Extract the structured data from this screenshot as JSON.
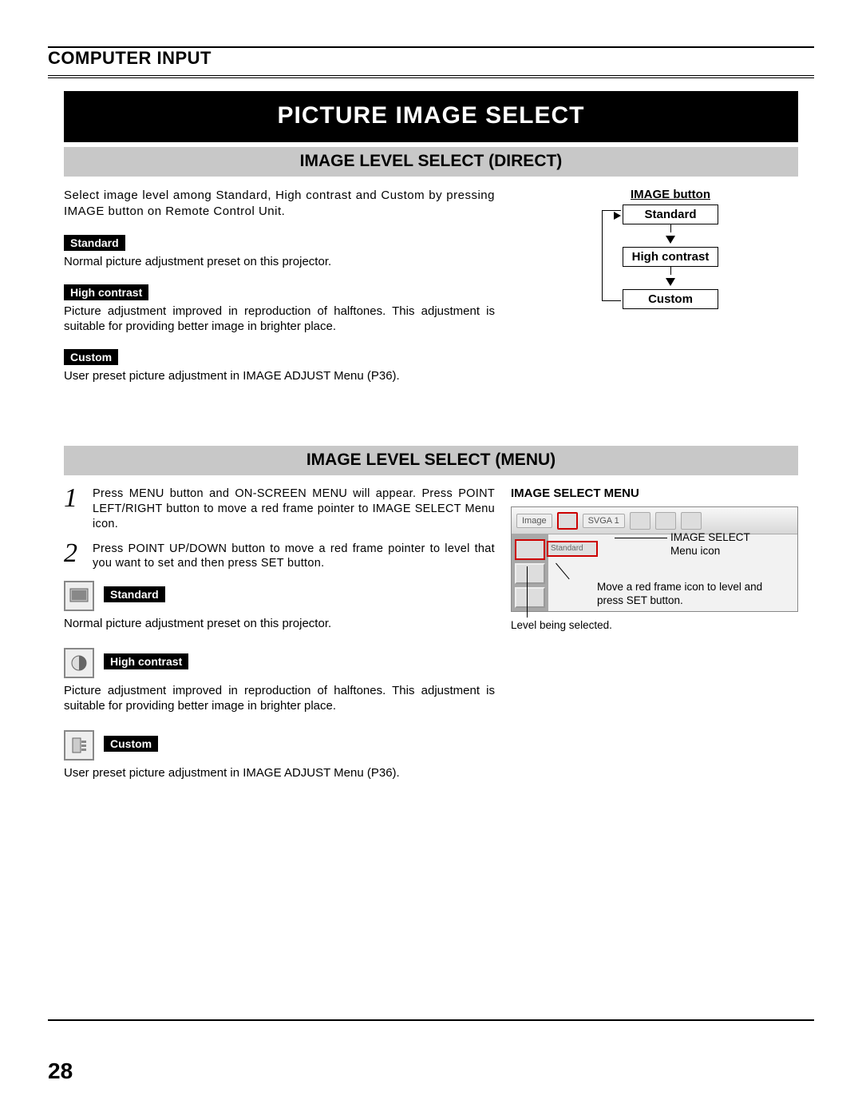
{
  "header": "COMPUTER INPUT",
  "title_band": "PICTURE IMAGE SELECT",
  "sec1": {
    "heading": "IMAGE LEVEL SELECT (DIRECT)",
    "intro": "Select image level among Standard, High contrast and Custom by pressing IMAGE button on Remote Control Unit.",
    "items": [
      {
        "label": "Standard",
        "desc": "Normal picture adjustment preset on this projector."
      },
      {
        "label": "High contrast",
        "desc": "Picture adjustment improved in reproduction of halftones. This adjustment is suitable for providing better image in brighter place."
      },
      {
        "label": "Custom",
        "desc": "User preset picture adjustment in IMAGE ADJUST Menu (P36)."
      }
    ],
    "flow_title": "IMAGE button",
    "flow_boxes": [
      "Standard",
      "High contrast",
      "Custom"
    ]
  },
  "sec2": {
    "heading": "IMAGE LEVEL SELECT (MENU)",
    "steps": [
      {
        "n": "1",
        "text": "Press MENU button and ON-SCREEN MENU will appear.  Press POINT LEFT/RIGHT button to move a red frame pointer to IMAGE SELECT Menu icon."
      },
      {
        "n": "2",
        "text": "Press POINT UP/DOWN button to move a red frame pointer to level that you want to set and then press SET button."
      }
    ],
    "items": [
      {
        "label": "Standard",
        "desc": "Normal picture adjustment preset on this projector."
      },
      {
        "label": "High contrast",
        "desc": "Picture adjustment improved in reproduction of halftones. This adjustment is suitable for providing better image in brighter place."
      },
      {
        "label": "Custom",
        "desc": "User preset picture adjustment in IMAGE ADJUST Menu (P36)."
      }
    ],
    "menu_title": "IMAGE SELECT MENU",
    "menu_tab": "Image",
    "menu_mode": "SVGA 1",
    "menu_drop": "Standard",
    "callouts": {
      "icon": "IMAGE SELECT Menu icon",
      "move": "Move a red frame icon to level and press SET button.",
      "level": "Level being selected."
    }
  },
  "page_number": "28"
}
